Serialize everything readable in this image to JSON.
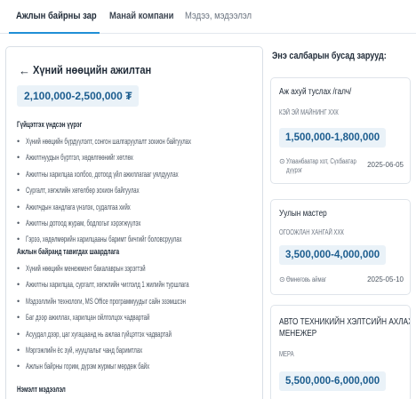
{
  "tabs": [
    {
      "label": "Ажлын байрны зар"
    },
    {
      "label": "Манай компани"
    },
    {
      "label": "Мэдээ, мэдээлэл"
    }
  ],
  "colors": {
    "accent": "#1f8fd6",
    "salary_text": "#1c5d8f",
    "salary_bg": "#eaf2f8"
  },
  "job": {
    "back_icon": "arrow-left-icon",
    "back_symbol": "←",
    "title": "Хүний нөөцийн ажилтан",
    "salary": "2,100,000-2,500,000 ₮",
    "sections": [
      {
        "heading": "Гүйцэтгэх үндсэн үүрэг",
        "items": [
          "Хүний нөөцийн бүрдүүлэлт, сонгон шалгаруулалт зохион байгуулах",
          "Ажилтнуудын бүртгэл, хөдөлгөөнийг хөтлөх",
          "Ажилтны харилцаа холбоо, дотоод үйл ажиллагааг уялдуулах",
          "Сургалт, хөгжлийн хөтөлбөр зохион байгуулах",
          "Ажилчдын хандлага үнэлэх, судалгаа хийх",
          "Ажилтны дотоод журам, бодлогыг хэрэгжүүлэх",
          "Гэрээ, хөдөлмөрийн харилцааны баримт бичгийг боловсруулах"
        ]
      },
      {
        "heading": "Ажлын байранд тавигдах шаардлага",
        "items": [
          "Хүний нөөцийн менежмент бакалаврын зэрэгтэй",
          "Ажилтны харилцаа, сургалт, хөгжлийн чиглэлд 1 жилийн туршлага",
          "Мэдээллийн технологи, MS Office программуудыг сайн эзэмшсэн",
          "Баг дээр ажиллах, харилцан ойлголцох чадвартай",
          "Асуудал дээр, цаг хугацаанд нь ажлаа гүйцэтгэх чадвартай",
          "Мэргэжлийн ёс зүй, нууцлалыг чанд баримтлах",
          "Ажлын байрны горим, дүрэм журмыг мөрдөж байх"
        ]
      },
      {
        "heading": "Нэмэлт мэдээлэл",
        "items": []
      }
    ]
  },
  "sidebar": {
    "title": "Энэ салбарын бусад зарууд:",
    "location_icon": "map-pin-icon",
    "location_symbol": "⊙",
    "cards": [
      {
        "title": "Аж ахуй туслах /галч/",
        "company": "КЭЙ ЭЙ МАЙНИНГ ХХК",
        "salary": "1,500,000-1,800,000",
        "location_line1": "Улаанбаатар хот, Сүхбаатар",
        "location_line2": "дүүрэг",
        "date": "2025-06-05"
      },
      {
        "title": "Уулын мастер",
        "company": "ОГООЖЛАН ХАНГАЙ ХХК",
        "salary": "3,500,000-4,000,000",
        "location_line1": "Өмнөговь аймаг",
        "location_line2": "",
        "date": "2025-05-10"
      },
      {
        "title_line1": "АВТО ТЕХНИКИЙН ХЭЛТСИЙН АХЛАХ",
        "title_line2": "МЕНЕЖЕР",
        "company": "МЕРА",
        "salary": "5,500,000-6,000,000"
      }
    ]
  }
}
